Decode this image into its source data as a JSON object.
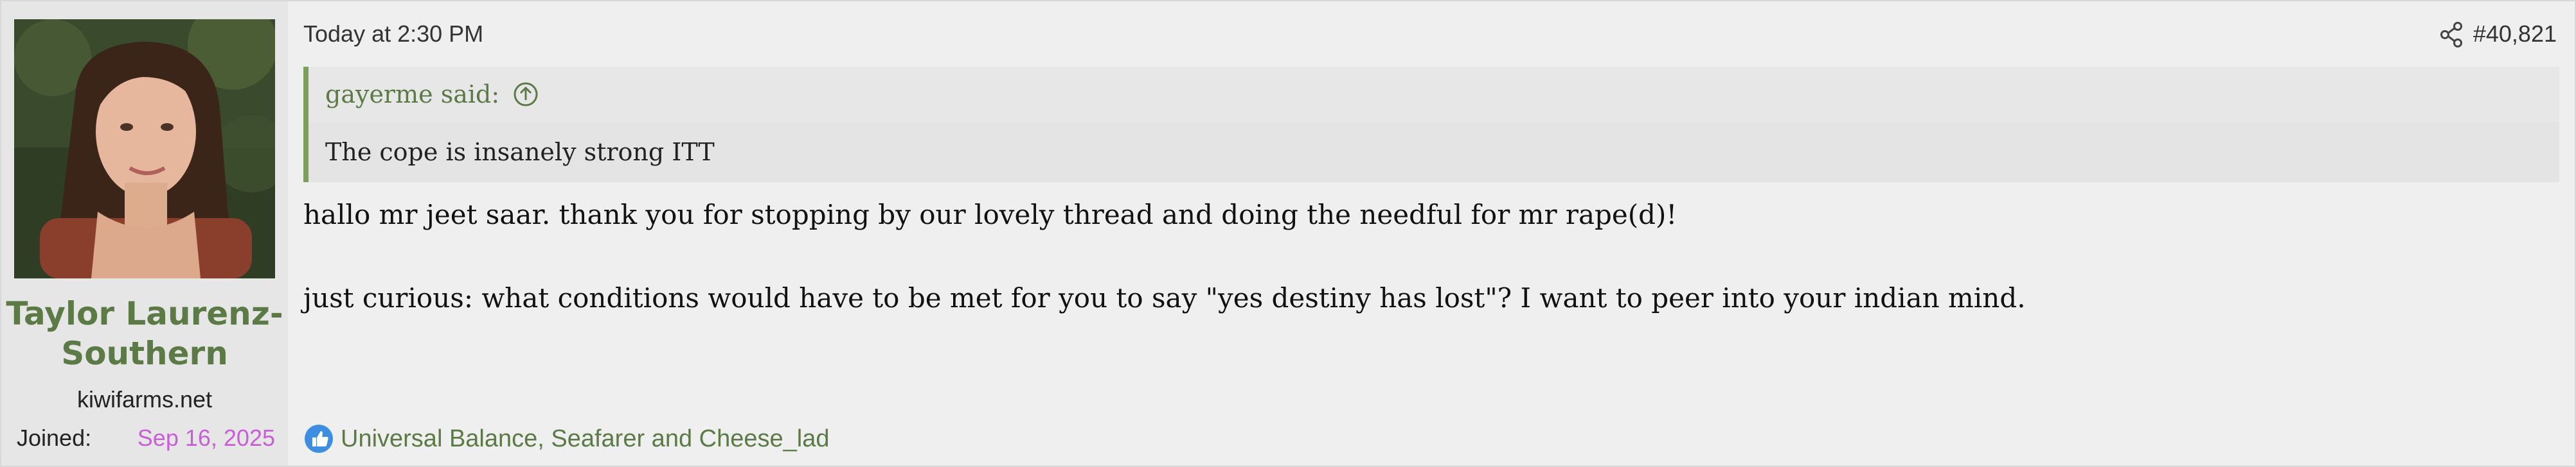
{
  "user": {
    "name_line1": "Taylor Laurenz-",
    "name_line2": "Southern",
    "site": "kiwifarms.net",
    "joined_label": "Joined:",
    "joined_date": "Sep 16, 2025",
    "avatar_icon": "user-avatar-photo"
  },
  "post": {
    "timestamp": "Today at 2:30 PM",
    "number": "#40,821",
    "share_icon": "share-icon",
    "quote": {
      "author": "gayerme said:",
      "text": "The cope is insanely strong ITT",
      "jump_icon": "arrow-up-circle-icon"
    },
    "paragraphs": [
      "hallo mr jeet saar. thank you for stopping by our lovely thread and doing the needful for mr rape(d)!",
      "just curious: what conditions would have to be met for you to say \"yes destiny has lost\"? I want to peer into your indian mind."
    ],
    "reactions": {
      "icon": "like-icon",
      "text": "Universal Balance, Seafarer and Cheese_lad"
    }
  },
  "colors": {
    "accent_green": "#5b7a45",
    "quote_bar": "#7ba05b",
    "joined_date": "#c85ed8",
    "like_blue": "#3d8ee0"
  }
}
